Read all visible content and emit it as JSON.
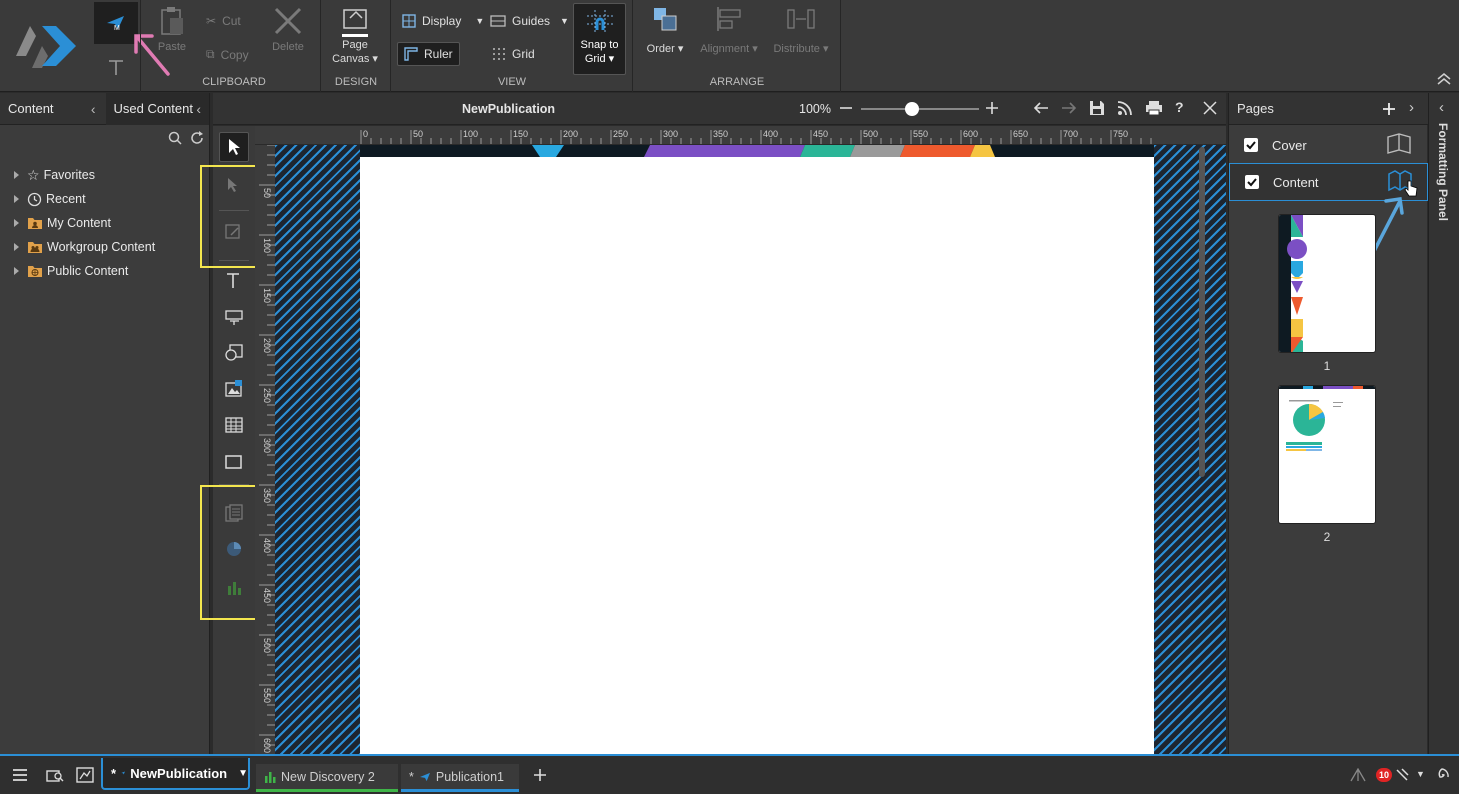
{
  "ribbon": {
    "clipboard": {
      "paste": "Paste",
      "cut": "Cut",
      "copy": "Copy",
      "delete": "Delete",
      "group": "CLIPBOARD"
    },
    "design": {
      "page_canvas_line1": "Page",
      "page_canvas_line2": "Canvas ▾",
      "group": "DESIGN"
    },
    "view": {
      "display": "Display",
      "guides": "Guides",
      "ruler": "Ruler",
      "grid": "Grid",
      "snap_line1": "Snap to",
      "snap_line2": "Grid ▾",
      "group": "VIEW"
    },
    "arrange": {
      "order": "Order ▾",
      "alignment": "Alignment ▾",
      "distribute": "Distribute ▾",
      "group": "ARRANGE"
    }
  },
  "left_panel": {
    "tab_content": "Content",
    "tab_used": "Used Content",
    "tree": [
      "Favorites",
      "Recent",
      "My Content",
      "Workgroup Content",
      "Public Content"
    ]
  },
  "document": {
    "title": "NewPublication",
    "zoom": "100%"
  },
  "ruler": {
    "top_ticks": [
      "0",
      "50",
      "100",
      "150",
      "200",
      "250",
      "300",
      "350",
      "400",
      "450",
      "500",
      "550",
      "600",
      "650",
      "700",
      "750"
    ],
    "left_ticks": [
      "50",
      "100",
      "150",
      "200",
      "250",
      "300",
      "350",
      "400",
      "450",
      "500",
      "550",
      "600"
    ]
  },
  "pages_panel": {
    "title": "Pages",
    "pages": [
      {
        "name": "Cover",
        "checked": true
      },
      {
        "name": "Content",
        "checked": true
      }
    ],
    "thumb_numbers": [
      "1",
      "2"
    ]
  },
  "formatting_panel": {
    "label": "Formatting Panel"
  },
  "taskbar": {
    "tabs": [
      {
        "prefix": "*",
        "label": "NewPublication"
      },
      {
        "label": "New Discovery 2"
      },
      {
        "prefix": "*",
        "label": "Publication1"
      }
    ],
    "notification_count": "10"
  },
  "colors": {
    "accent": "#2b8fd6",
    "highlight": "#f3e64e",
    "pink_arrow": "#e07bb3"
  }
}
